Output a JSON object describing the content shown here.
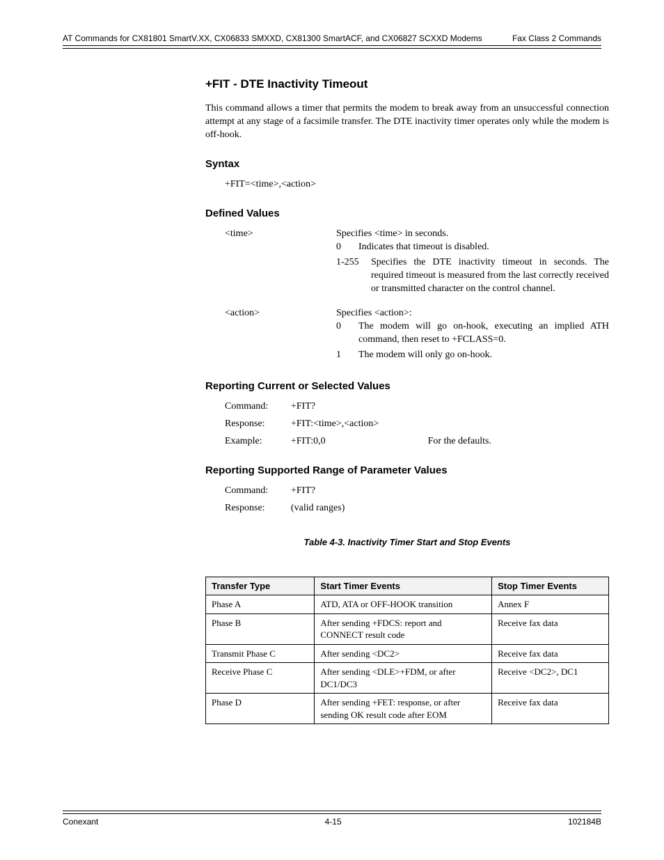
{
  "header": {
    "left": "AT Commands for CX81801 SmartV.XX, CX06833 SMXXD, CX81300 SmartACF, and CX06827 SCXXD Modems",
    "right": "Fax Class 2 Commands"
  },
  "section_title": "+FIT - DTE Inactivity Timeout",
  "intro": "This command allows a timer that permits the modem to break away from an unsuccessful connection attempt at any stage of a facsimile transfer. The DTE inactivity timer operates only while the modem is off-hook.",
  "syntax_title": "Syntax",
  "syntax_line": "+FIT=<time>,<action>",
  "defined_values_title": "Defined Values",
  "def_time_term": "<time>",
  "def_time_desc_lead": "Specifies <time> in seconds.",
  "def_time_0": "0",
  "def_time_0_desc": "Indicates that timeout is disabled.",
  "def_time_1": "1-255",
  "def_time_1_desc": "Specifies the DTE inactivity timeout in seconds. The required timeout is measured from the last correctly received or transmitted character on the control channel.",
  "def_action_term": "<action>",
  "def_action_desc_lead": "Specifies <action>:",
  "def_action_0": "0",
  "def_action_0_desc": "The modem will go on-hook, executing an implied ATH command, then reset to +FCLASS=0.",
  "def_action_1": "1",
  "def_action_1_desc": "The modem will only go on-hook.",
  "reporting1_title": "Reporting Current or Selected Values",
  "r1_command_label": "Command:",
  "r1_command_val": "+FIT?",
  "r1_response_label": "Response:",
  "r1_response_val": "+FIT:<time>,<action>",
  "r1_example_label": "Example:",
  "r1_example_val": "+FIT:0,0",
  "r1_example_note": "For the defaults.",
  "reporting2_title": "Reporting Supported Range of Parameter Values",
  "r2_command_label": "Command:",
  "r2_command_val": "+FIT?",
  "r2_response_label": "Response:",
  "r2_response_val": "(valid ranges)",
  "table_caption": "Table 4-3. Inactivity Timer Start and Stop Events",
  "th1": "Transfer Type",
  "th2": "Start Timer Events",
  "th3": "Stop Timer Events",
  "r_a1": "Phase A",
  "r_a2": "ATD, ATA or OFF-HOOK transition",
  "r_a3": "Annex F",
  "r_b1": "Phase B",
  "r_b2": "After sending +FDCS: report and CONNECT result code",
  "r_b3": "Receive fax data",
  "r_t_c1": "Transmit Phase C",
  "r_t_c2": "After sending <DC2>",
  "r_t_c3": "Receive fax data",
  "r_r_c1": "Receive Phase C",
  "r_r_c2": "After sending <DLE>+FDM, or after DC1/DC3",
  "r_r_c3": "Receive <DC2>, DC1",
  "r_d1": "Phase D",
  "r_d2": "After sending +FET: response, or after sending OK result code after EOM",
  "r_d3": "Receive fax data",
  "footer": {
    "left": "Conexant",
    "center": "4-15",
    "right": "102184B"
  }
}
